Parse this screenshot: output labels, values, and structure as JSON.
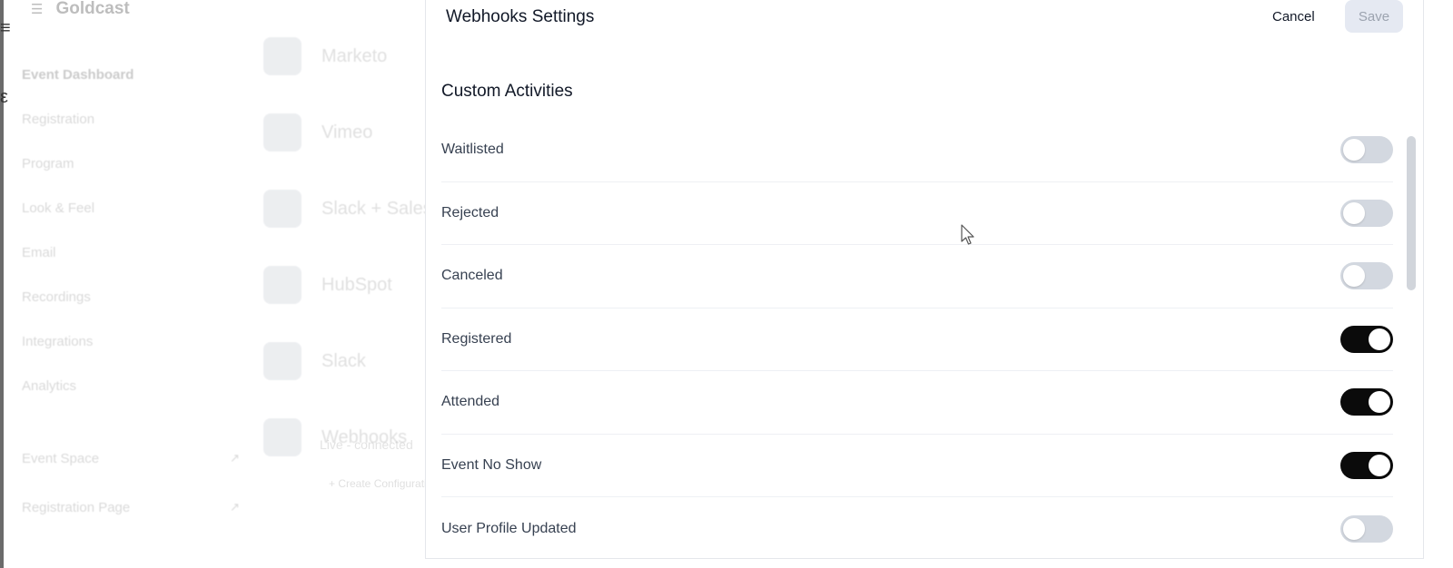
{
  "background": {
    "glyphs": [
      "≡",
      "ε"
    ],
    "menu_icon": "hamburger-icon",
    "logo_text": "Goldcast",
    "nav_items": [
      {
        "label": "Event Dashboard",
        "bold": true
      },
      {
        "label": "Registration",
        "bold": false
      },
      {
        "label": "Program",
        "bold": false
      },
      {
        "label": "Look & Feel",
        "bold": false
      },
      {
        "label": "Email",
        "bold": false
      },
      {
        "label": "Recordings",
        "bold": false
      },
      {
        "label": "Integrations",
        "bold": false
      },
      {
        "label": "Analytics",
        "bold": false
      }
    ],
    "nav_secondary": [
      {
        "label": "Event Space",
        "icon": "external-link-icon"
      },
      {
        "label": "Registration Page",
        "icon": "external-link-icon"
      }
    ],
    "integrations": [
      {
        "name": "Marketo"
      },
      {
        "name": "Vimeo"
      },
      {
        "name": "Slack + Salesforce"
      },
      {
        "name": "HubSpot"
      },
      {
        "name": "Slack"
      },
      {
        "name": "Webhooks"
      }
    ],
    "integration_sub": "Live - connected",
    "integration_link": "+ Create Configuration"
  },
  "panel": {
    "title": "Webhooks Settings",
    "cancel_label": "Cancel",
    "save_label": "Save",
    "section_title": "Custom Activities",
    "activities": [
      {
        "label": "Waitlisted",
        "enabled": false
      },
      {
        "label": "Rejected",
        "enabled": false
      },
      {
        "label": "Canceled",
        "enabled": false
      },
      {
        "label": "Registered",
        "enabled": true
      },
      {
        "label": "Attended",
        "enabled": true
      },
      {
        "label": "Event No Show",
        "enabled": true
      },
      {
        "label": "User Profile Updated",
        "enabled": false
      }
    ]
  },
  "colors": {
    "toggle_on": "#0b0b0b",
    "toggle_off": "#d3d8e0",
    "save_disabled_bg": "#e5e9f2"
  }
}
